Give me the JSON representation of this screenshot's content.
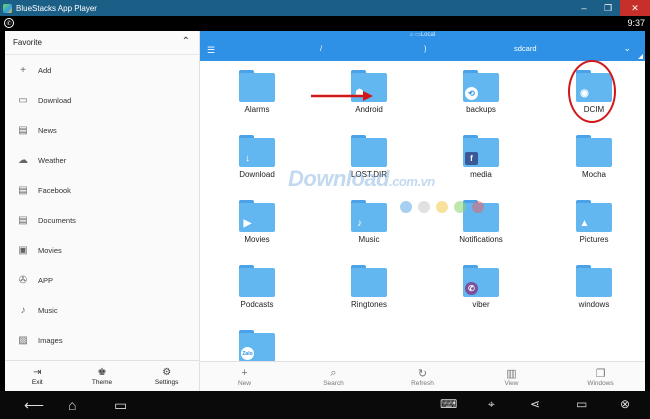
{
  "window": {
    "title": "BlueStacks App Player",
    "controls": [
      "–",
      "❐",
      "✕"
    ]
  },
  "status_bar": {
    "time": "9:37"
  },
  "sidebar": {
    "header": "Favorite",
    "items": [
      {
        "label": "Add",
        "icon": "plus-icon",
        "glyph": "+"
      },
      {
        "label": "Download",
        "icon": "download-icon",
        "glyph": "▭"
      },
      {
        "label": "News",
        "icon": "news-icon",
        "glyph": "▤"
      },
      {
        "label": "Weather",
        "icon": "cloud-icon",
        "glyph": "☁"
      },
      {
        "label": "Facebook",
        "icon": "facebook-icon",
        "glyph": "▤"
      },
      {
        "label": "Documents",
        "icon": "documents-icon",
        "glyph": "▤"
      },
      {
        "label": "Movies",
        "icon": "movie-icon",
        "glyph": "▣"
      },
      {
        "label": "APP",
        "icon": "app-icon",
        "glyph": "✇"
      },
      {
        "label": "Music",
        "icon": "music-icon",
        "glyph": "♪"
      },
      {
        "label": "Images",
        "icon": "image-icon",
        "glyph": "▨"
      }
    ],
    "bottom": [
      {
        "label": "Exit",
        "glyph": "⇥"
      },
      {
        "label": "Theme",
        "glyph": "♚"
      },
      {
        "label": "Settings",
        "glyph": "⚙"
      }
    ]
  },
  "toolbar": {
    "location": "Local",
    "breadcrumb": [
      "/",
      ")",
      "sdcard"
    ]
  },
  "folders": [
    {
      "label": "Alarms",
      "badge": ""
    },
    {
      "label": "Android",
      "badge": "☗"
    },
    {
      "label": "backups",
      "badge": "⟲"
    },
    {
      "label": "DCIM",
      "badge": "◉"
    },
    {
      "label": "Download",
      "badge": "↓"
    },
    {
      "label": "LOST.DIR",
      "badge": ""
    },
    {
      "label": "media",
      "badge": "f"
    },
    {
      "label": "Mocha",
      "badge": ""
    },
    {
      "label": "Movies",
      "badge": "▶"
    },
    {
      "label": "Music",
      "badge": "♪"
    },
    {
      "label": "Notifications",
      "badge": ""
    },
    {
      "label": "Pictures",
      "badge": "▲"
    },
    {
      "label": "Podcasts",
      "badge": ""
    },
    {
      "label": "Ringtones",
      "badge": ""
    },
    {
      "label": "viber",
      "badge": "✆"
    },
    {
      "label": "windows",
      "badge": ""
    },
    {
      "label": "",
      "badge": "Zalo"
    }
  ],
  "bottom_bar": [
    {
      "label": "New",
      "glyph": "+"
    },
    {
      "label": "Search",
      "glyph": "⌕"
    },
    {
      "label": "Refresh",
      "glyph": "↻"
    },
    {
      "label": "View",
      "glyph": "▥"
    },
    {
      "label": "Windows",
      "glyph": "❐"
    }
  ],
  "watermark": {
    "text": "Download",
    "suffix": ".com.vn"
  },
  "dots_colors": [
    "#5fa8e8",
    "#c9c9c9",
    "#f2c84b",
    "#8cd36a",
    "#e8656e"
  ],
  "accent_color": "#2e91e6",
  "annotation_color": "#d01818"
}
